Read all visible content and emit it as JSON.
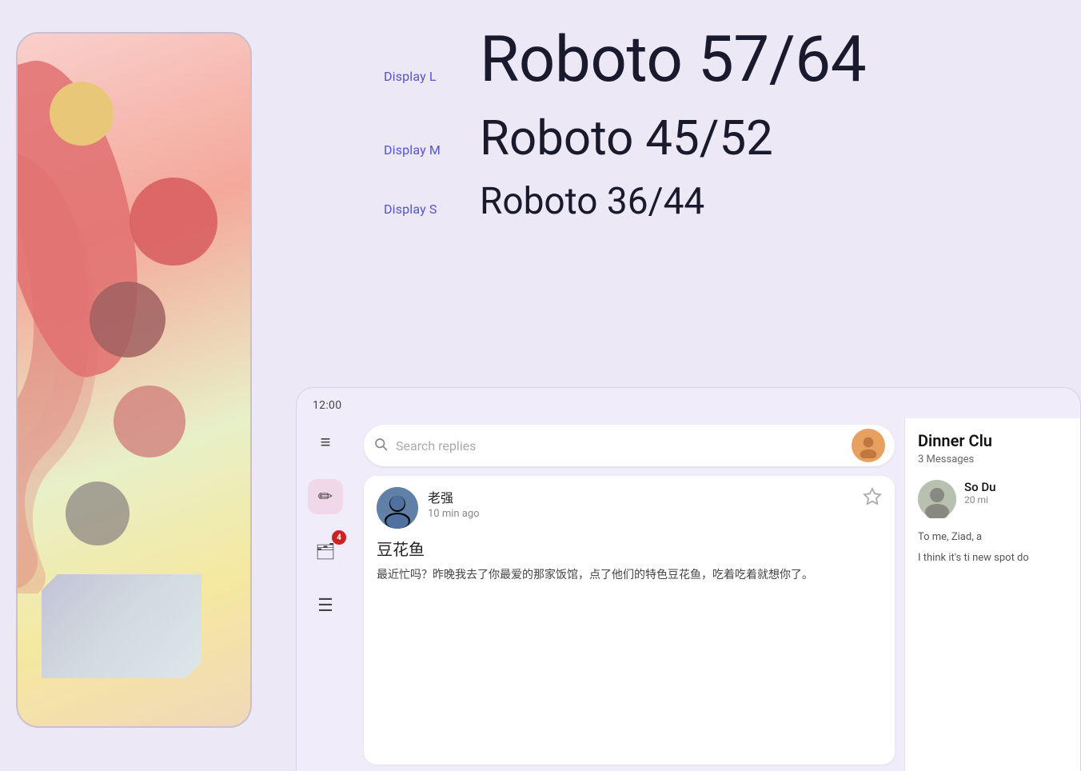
{
  "background_color": "#ede8f5",
  "typography": {
    "rows": [
      {
        "label": "Display L",
        "text": "Roboto 57/64",
        "size_class": "type-display-l"
      },
      {
        "label": "Display M",
        "text": "Roboto 45/52",
        "size_class": "type-display-m"
      },
      {
        "label": "Display S",
        "text": "Roboto 36/44",
        "size_class": "type-display-s"
      }
    ]
  },
  "app": {
    "time": "12:00",
    "search_placeholder": "Search replies",
    "sidebar_icons": [
      {
        "name": "hamburger-menu",
        "symbol": "≡",
        "active": false
      },
      {
        "name": "compose",
        "symbol": "✏",
        "active": true
      },
      {
        "name": "inbox",
        "symbol": "🗂",
        "badge": "4",
        "active": false
      },
      {
        "name": "notes",
        "symbol": "☰",
        "active": false
      }
    ],
    "message": {
      "sender_name": "老强",
      "time_ago": "10 min ago",
      "title": "豆花鱼",
      "body": "最近忙吗？昨晚我去了你最爱的那家饭馆，点了他们的特色豆花鱼，吃着吃着就想你了。"
    },
    "right_panel": {
      "group_name": "Dinner Clu",
      "messages_count": "3 Messages",
      "contact": {
        "name": "So Du",
        "time": "20 mi",
        "preview": "To me, Ziad, a",
        "preview2": "I think it's ti new spot do"
      }
    }
  }
}
